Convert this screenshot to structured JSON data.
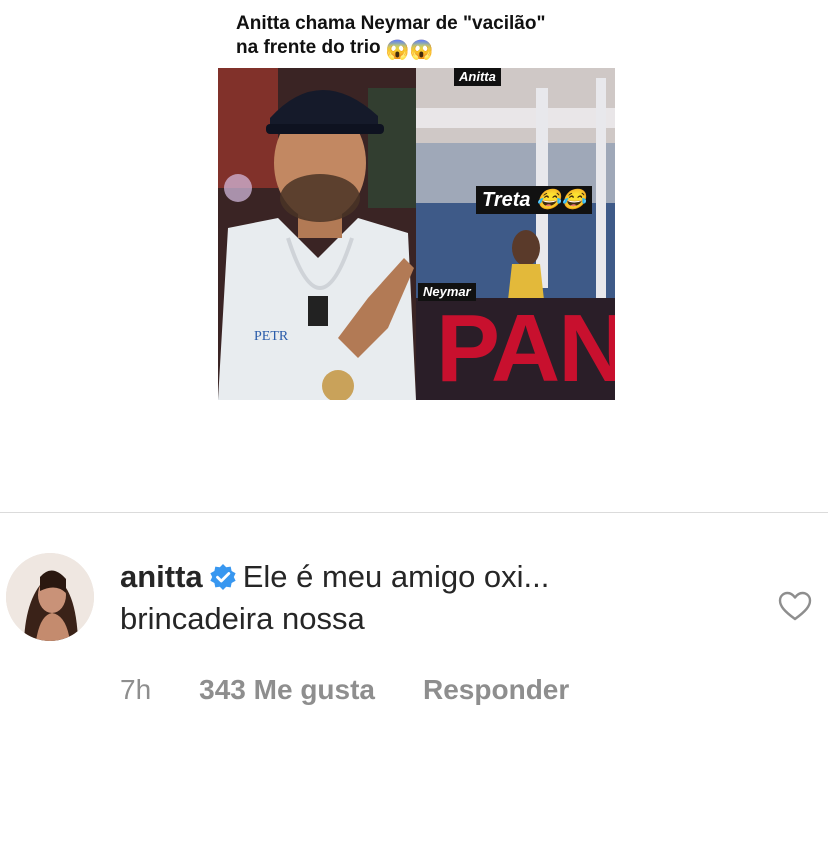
{
  "post": {
    "headline_line1": "Anitta chama Neymar de  \"vacilão\"",
    "headline_line2": "na frente do trio",
    "headline_emoji": "😱😱",
    "tag_anitta": "Anitta",
    "tag_treta": "Treta",
    "tag_treta_emoji": "😂😂",
    "tag_neymar": "Neymar",
    "sign_text": "PANI"
  },
  "comment": {
    "username": "anitta",
    "text_line1": "Ele é meu amigo oxi...",
    "text_line2": "brincadeira nossa",
    "time": "7h",
    "likes": "343 Me gusta",
    "reply_label": "Responder",
    "verified_color": "#3897f0"
  }
}
